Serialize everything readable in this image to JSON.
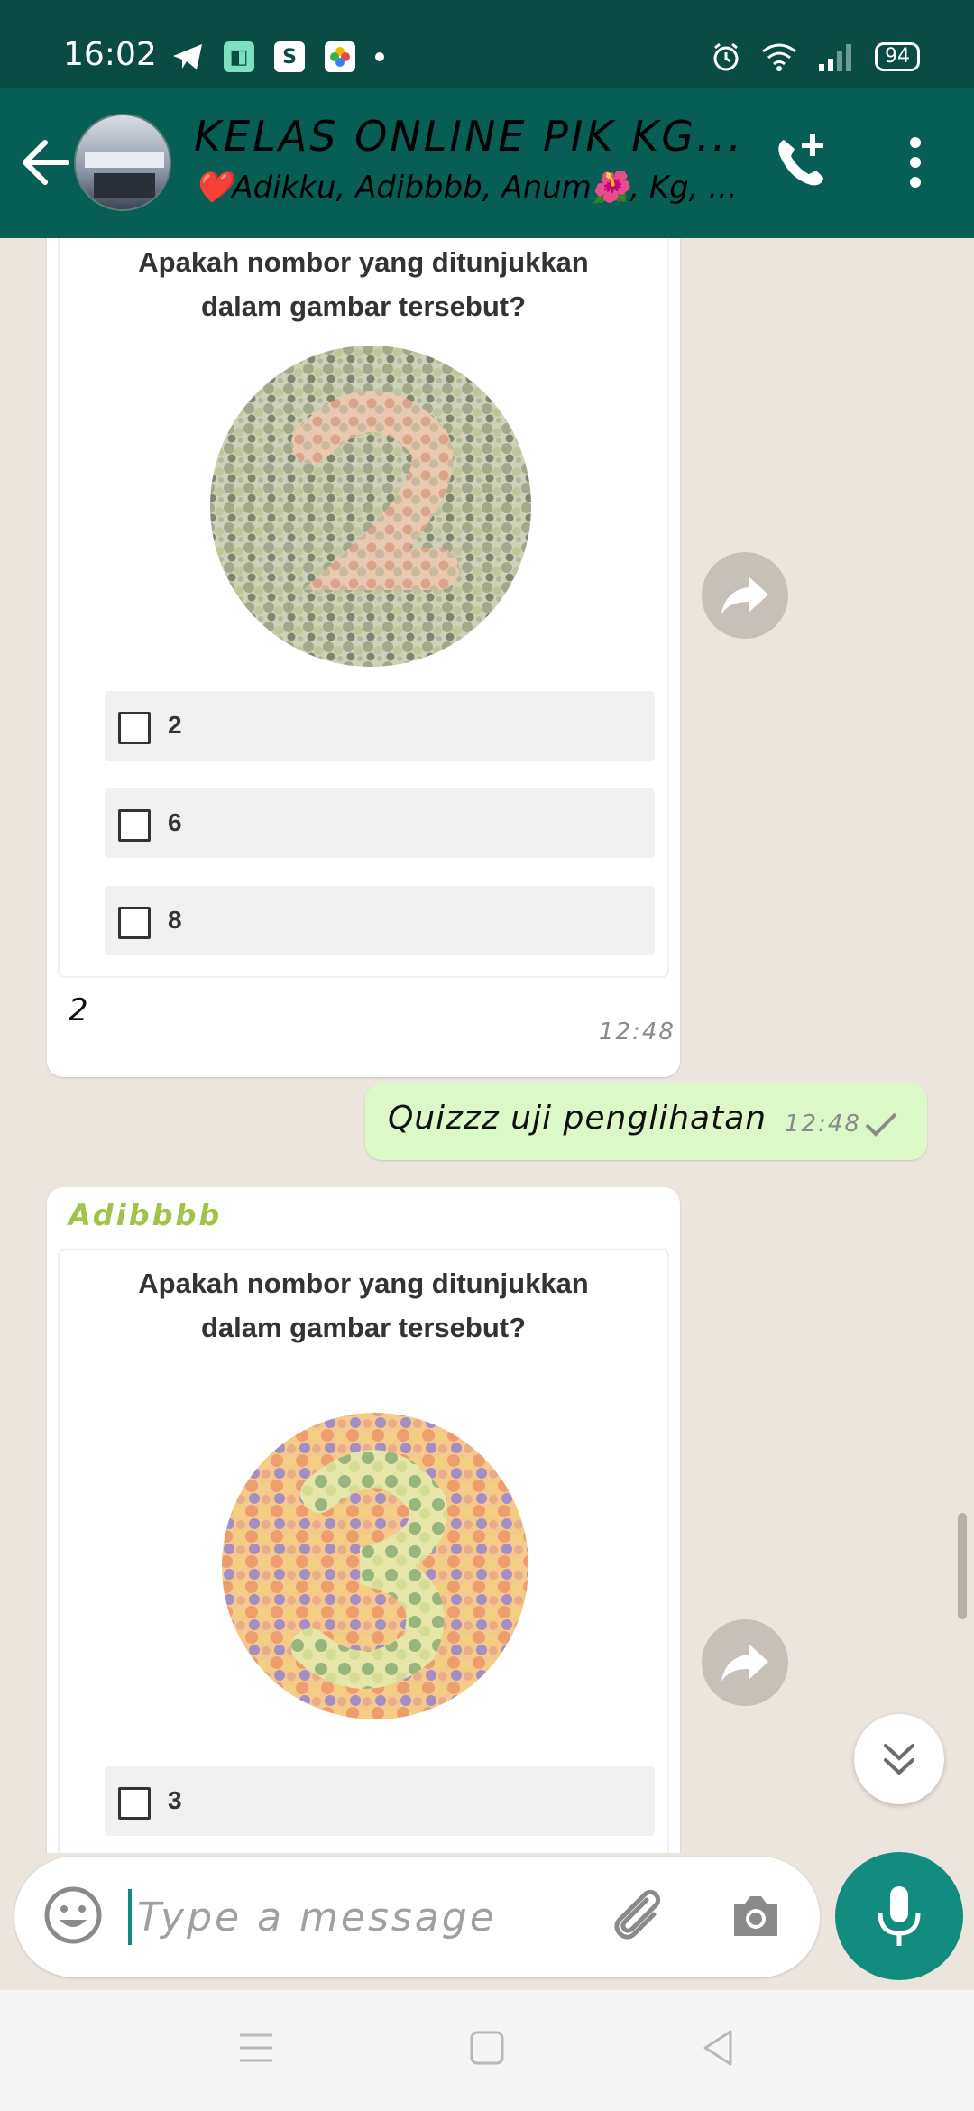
{
  "status_bar": {
    "time": "16:02",
    "battery": "94",
    "app_icons": [
      "telegram-icon",
      "app-icon",
      "shopee-icon",
      "photos-icon"
    ]
  },
  "header": {
    "title": "KELAS ONLINE PIK KG...",
    "subtitle": "❤️Adikku, Adibbbb, Anum🌺, Kg, ...",
    "accent_color": "#075e54"
  },
  "messages": [
    {
      "type": "incoming-quiz",
      "question_line1": "Apakah nombor yang ditunjukkan",
      "question_line2": "dalam gambar tersebut?",
      "options": [
        "2",
        "6",
        "8"
      ],
      "caption": "2",
      "time": "12:48"
    },
    {
      "type": "outgoing",
      "text": "Quizzz uji penglihatan",
      "time": "12:48"
    },
    {
      "type": "incoming-quiz",
      "sender": "Adibbbb",
      "question_line1": "Apakah nombor yang ditunjukkan",
      "question_line2": "dalam gambar tersebut?",
      "options": [
        "3"
      ]
    }
  ],
  "composer": {
    "placeholder": "Type a message"
  },
  "colors": {
    "bubble_out": "#dcf8c6",
    "sender_name": "#a3c24a",
    "mic_button": "#128c7e"
  }
}
